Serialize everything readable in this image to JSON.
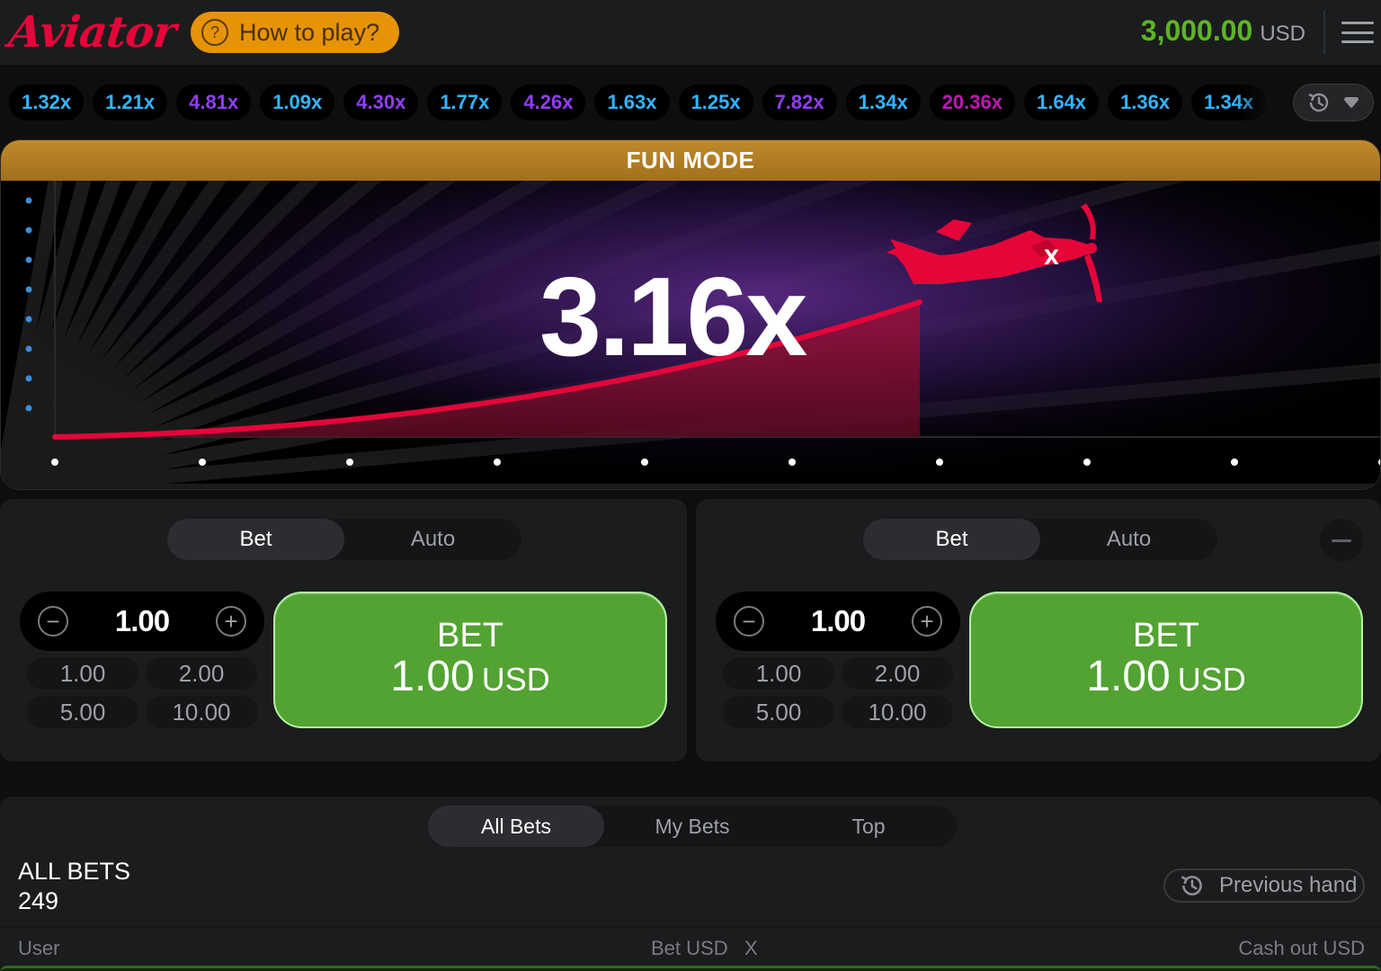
{
  "header": {
    "logo_text": "Aviator",
    "how_to_play": "How to play?",
    "balance_amount": "3,000.00",
    "balance_currency": "USD"
  },
  "history": {
    "items": [
      {
        "value": "1.32x",
        "color": "#34b4ff"
      },
      {
        "value": "1.21x",
        "color": "#34b4ff"
      },
      {
        "value": "4.81x",
        "color": "#913ef8"
      },
      {
        "value": "1.09x",
        "color": "#34b4ff"
      },
      {
        "value": "4.30x",
        "color": "#913ef8"
      },
      {
        "value": "1.77x",
        "color": "#34b4ff"
      },
      {
        "value": "4.26x",
        "color": "#913ef8"
      },
      {
        "value": "1.63x",
        "color": "#34b4ff"
      },
      {
        "value": "1.25x",
        "color": "#34b4ff"
      },
      {
        "value": "7.82x",
        "color": "#913ef8"
      },
      {
        "value": "1.34x",
        "color": "#34b4ff"
      },
      {
        "value": "20.36x",
        "color": "#c017b4"
      },
      {
        "value": "1.64x",
        "color": "#34b4ff"
      },
      {
        "value": "1.36x",
        "color": "#34b4ff"
      },
      {
        "value": "1.34x",
        "color": "#34b4ff"
      }
    ]
  },
  "game": {
    "banner": "FUN MODE",
    "multiplier": "3.16x",
    "curve_color": "#e50539"
  },
  "panels": [
    {
      "tabs": [
        "Bet",
        "Auto"
      ],
      "active_tab": "Bet",
      "amount": "1.00",
      "quick": [
        "1.00",
        "2.00",
        "5.00",
        "10.00"
      ],
      "bet_label": "BET",
      "bet_amount": "1.00",
      "bet_currency": "USD"
    },
    {
      "tabs": [
        "Bet",
        "Auto"
      ],
      "active_tab": "Bet",
      "amount": "1.00",
      "quick": [
        "1.00",
        "2.00",
        "5.00",
        "10.00"
      ],
      "bet_label": "BET",
      "bet_amount": "1.00",
      "bet_currency": "USD"
    }
  ],
  "bets": {
    "tabs": [
      "All Bets",
      "My Bets",
      "Top"
    ],
    "active_tab": "All Bets",
    "title": "ALL BETS",
    "count": "249",
    "previous_hand": "Previous hand",
    "columns": {
      "user": "User",
      "bet": "Bet USD",
      "x": "X",
      "cashout": "Cash out USD"
    }
  },
  "colors": {
    "accent_green": "#52a332",
    "balance_green": "#5db424",
    "brand_red": "#e50539",
    "gold": "#e69308"
  }
}
